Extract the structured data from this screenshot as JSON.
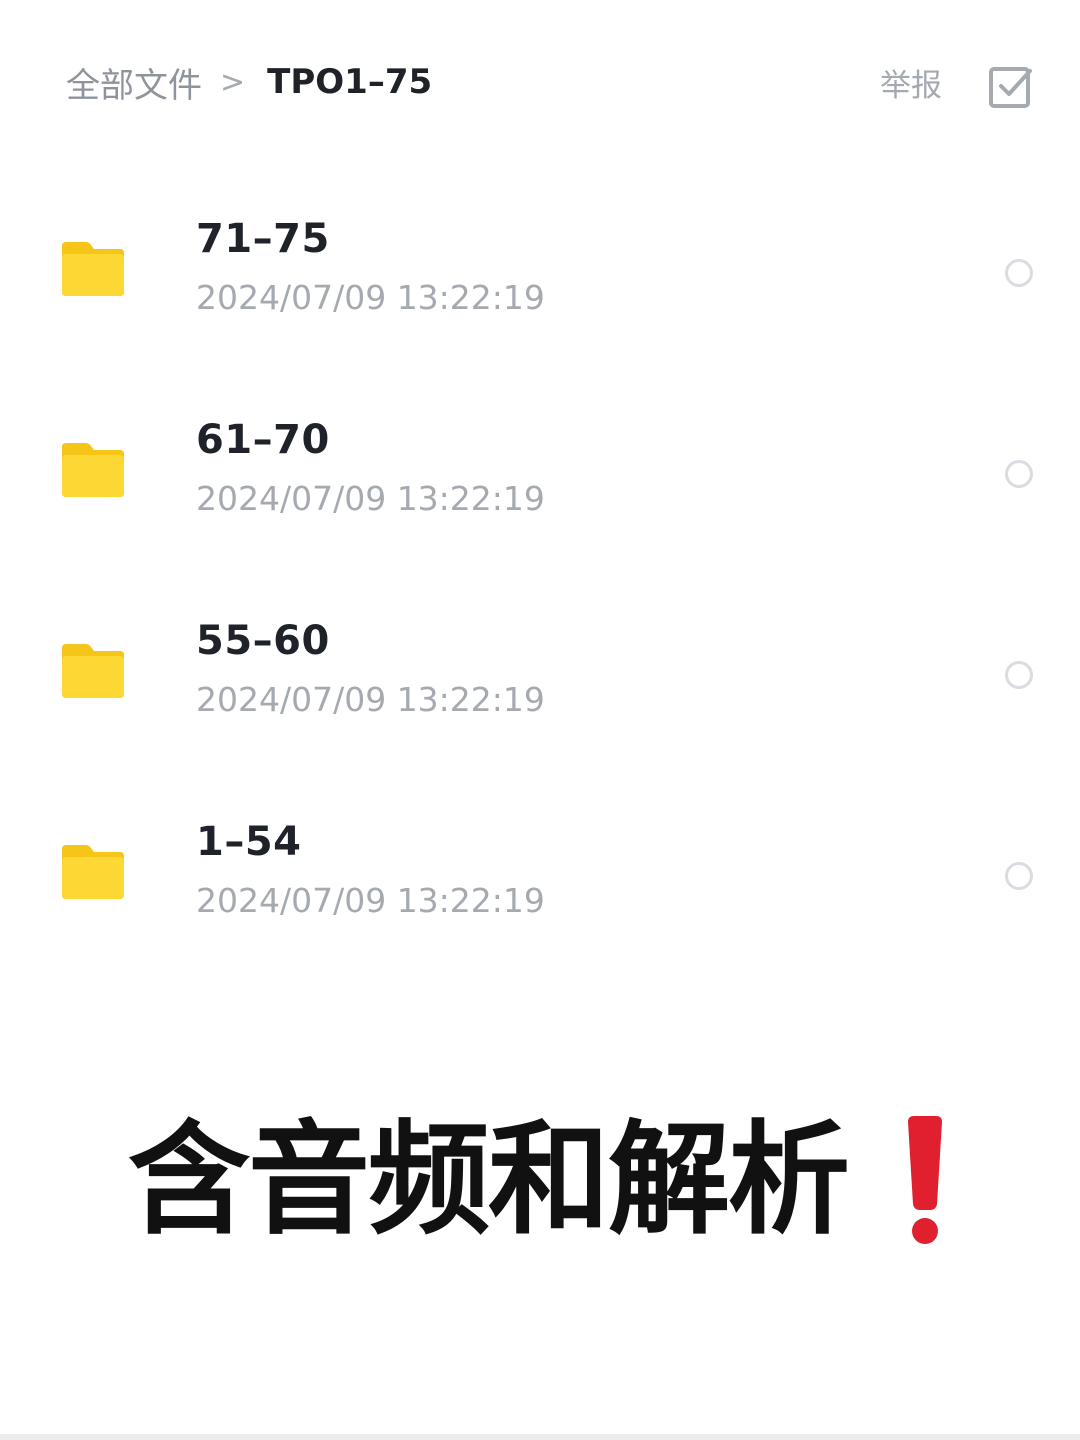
{
  "header": {
    "breadcrumb_root": "全部文件",
    "breadcrumb_separator": ">",
    "breadcrumb_current": "TPO1–75",
    "report_label": "举报",
    "multi_select_icon": "checkbox-square-icon"
  },
  "files": [
    {
      "name": "71–75",
      "time": "2024/07/09 13:22:19",
      "icon": "folder-icon"
    },
    {
      "name": "61–70",
      "time": "2024/07/09 13:22:19",
      "icon": "folder-icon"
    },
    {
      "name": "55–60",
      "time": "2024/07/09 13:22:19",
      "icon": "folder-icon"
    },
    {
      "name": "1–54",
      "time": "2024/07/09 13:22:19",
      "icon": "folder-icon"
    }
  ],
  "caption": {
    "text": "含音频和解析",
    "emoji_icon": "red-exclamation-icon"
  },
  "colors": {
    "folder": "#fdd835",
    "title": "#1f2329",
    "subtle": "#a5a9b0",
    "accent_red": "#e0202e"
  }
}
